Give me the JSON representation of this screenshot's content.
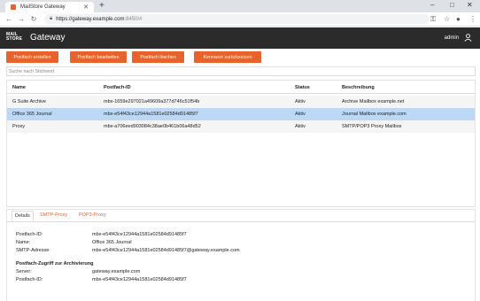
{
  "browser": {
    "tab_title": "MailStore Gateway",
    "url_host": "https://gateway.example.com",
    "url_rest": ":8450/#"
  },
  "header": {
    "logo_line1": "MAIL",
    "logo_line2": "STORE",
    "title": "Gateway",
    "user": "admin"
  },
  "toolbar": {
    "create": "Postfach erstellen",
    "edit": "Postfach bearbeiten",
    "delete": "Postfach löschen",
    "reset_password": "Kennwort zurücksetzen",
    "search_placeholder": "Suche nach Stichwort"
  },
  "table": {
    "columns": [
      "Name",
      "Postfach-ID",
      "Status",
      "Beschreibung"
    ],
    "rows": [
      [
        "G Suite Archive",
        "mbx-1659e297021a49609a377d746c51f54b",
        "Aktiv",
        "Archive Mailbox example.net"
      ],
      [
        "Office 365 Journal",
        "mbx-e54f43ce12944a1581e02584d91485f7",
        "Aktiv",
        "Journal Mailbox example.com"
      ],
      [
        "Proxy",
        "mbx-a706eed903084c38ae0b461b06a48d52",
        "Aktiv",
        "SMTP/POP3 Proxy Mailbox"
      ]
    ]
  },
  "details": {
    "tabs": [
      "Details",
      "SMTP-Proxy",
      "POP3-Proxy"
    ],
    "fields": [
      {
        "label": "Postfach-ID:",
        "value": "mbx-e54f43ce12944a1581e02584d91485f7"
      },
      {
        "label": "Name:",
        "value": "Office 365 Journal"
      },
      {
        "label": "SMTP-Adresse:",
        "value": "mbx-e54f43ce12944a1581e02584d91485f7@gateway.example.com"
      }
    ],
    "section_title": "Postfach-Zugriff zur Archivierung",
    "access_fields": [
      {
        "label": "Server:",
        "value": "gateway.example.com"
      },
      {
        "label": "Postfach-ID:",
        "value": "mbx-e54f43ce12944a1581e02584d91485f7"
      }
    ]
  }
}
